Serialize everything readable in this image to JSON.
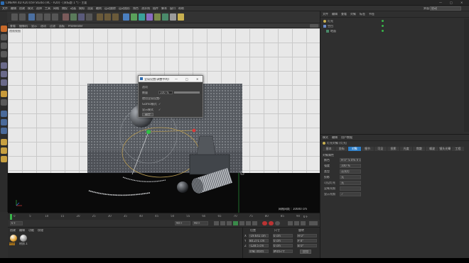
{
  "window": {
    "title": "CINEMA 4D R20.059 Studio (RC - R20) - [末标题 1 *] - 主要",
    "controls": [
      "—",
      "□",
      "✕"
    ]
  },
  "menubar": {
    "items": [
      "文件",
      "编辑",
      "创建",
      "模式",
      "选择",
      "工具",
      "网格",
      "捕捉",
      "动画",
      "模拟",
      "渲染",
      "雕刻",
      "运动跟踪",
      "运动图形",
      "角色",
      "流水线",
      "插件",
      "脚本",
      "窗口",
      "帮助"
    ],
    "layout_label": "界面:",
    "layout_value": "启动"
  },
  "viewport": {
    "menu": [
      "查看",
      "摄像机",
      "显示",
      "选项",
      "过滤",
      "面板",
      "ProRender"
    ],
    "label": "透视视图",
    "grid_info": "网格间距 : 10000 cm"
  },
  "dialog": {
    "title": "全局设置(调整中的)",
    "rows": [
      {
        "label": "选项",
        "value": ""
      },
      {
        "label": "数量",
        "value": "100 %"
      },
      {
        "label": "使用全局设置",
        "value": "✓"
      },
      {
        "label": "Gizmo模式",
        "value": "✓"
      },
      {
        "label": "显示模式",
        "value": "✓"
      }
    ],
    "button": "确定"
  },
  "objects": {
    "tabs": [
      "文件",
      "编辑",
      "查看",
      "对象",
      "标签",
      "书签"
    ],
    "items": [
      {
        "name": "灯光",
        "indent": 0
      },
      {
        "name": "空白",
        "indent": 0
      },
      {
        "name": "地面",
        "indent": 1
      }
    ]
  },
  "attributes": {
    "tabs": [
      "模式",
      "编辑",
      "用户数据"
    ],
    "object_label": "灯光对象 [灯光]",
    "subtabs": [
      "基本",
      "坐标",
      "对象",
      "细节",
      "可见",
      "投影",
      "光度",
      "焦散",
      "噪波",
      "镜头光晕",
      "工程"
    ],
    "active_subtab": "对象",
    "section": "对象属性",
    "fields": [
      {
        "label": "颜色",
        "value": "H 0° S 0% V 100%"
      },
      {
        "label": "强度",
        "value": "100 %"
      },
      {
        "label": "类型",
        "value": "泛光灯"
      },
      {
        "label": "投影",
        "value": "无"
      },
      {
        "label": "可见灯光",
        "value": "无"
      },
      {
        "label": "没有光照",
        "value": ""
      },
      {
        "label": "显示光照",
        "value": "✓"
      }
    ]
  },
  "timeline": {
    "ticks": [
      "0",
      "5",
      "10",
      "15",
      "20",
      "25",
      "30",
      "35",
      "40",
      "45",
      "50",
      "55",
      "60",
      "65",
      "70",
      "75",
      "80",
      "85",
      "90"
    ],
    "frame_end": "0 F",
    "start": "0 F",
    "end": "90 F",
    "current": "90 F"
  },
  "materials": {
    "menu": [
      "创建",
      "编辑",
      "功能",
      "纹理"
    ],
    "items": [
      {
        "name": "材质"
      },
      {
        "name": "材质.1"
      }
    ]
  },
  "coords": {
    "headers": [
      "位置",
      "尺寸",
      "旋转"
    ],
    "rows": [
      {
        "axis": "X",
        "pos": "-19.641 cm",
        "size": "0 cm",
        "rot": "H 0°"
      },
      {
        "axis": "Y",
        "pos": "80.271 cm",
        "size": "0 cm",
        "rot": "P 0°"
      },
      {
        "axis": "Z",
        "pos": "-128.5 cm",
        "size": "0 cm",
        "rot": "B 0°"
      }
    ],
    "mode": "对象 (相对)",
    "size_mode": "绝对尺寸",
    "apply": "应用"
  },
  "colors": {
    "accent": "#2d7ec8",
    "dialog_bg": "#3d3d3d",
    "grid_line": "#c9c9c9"
  }
}
